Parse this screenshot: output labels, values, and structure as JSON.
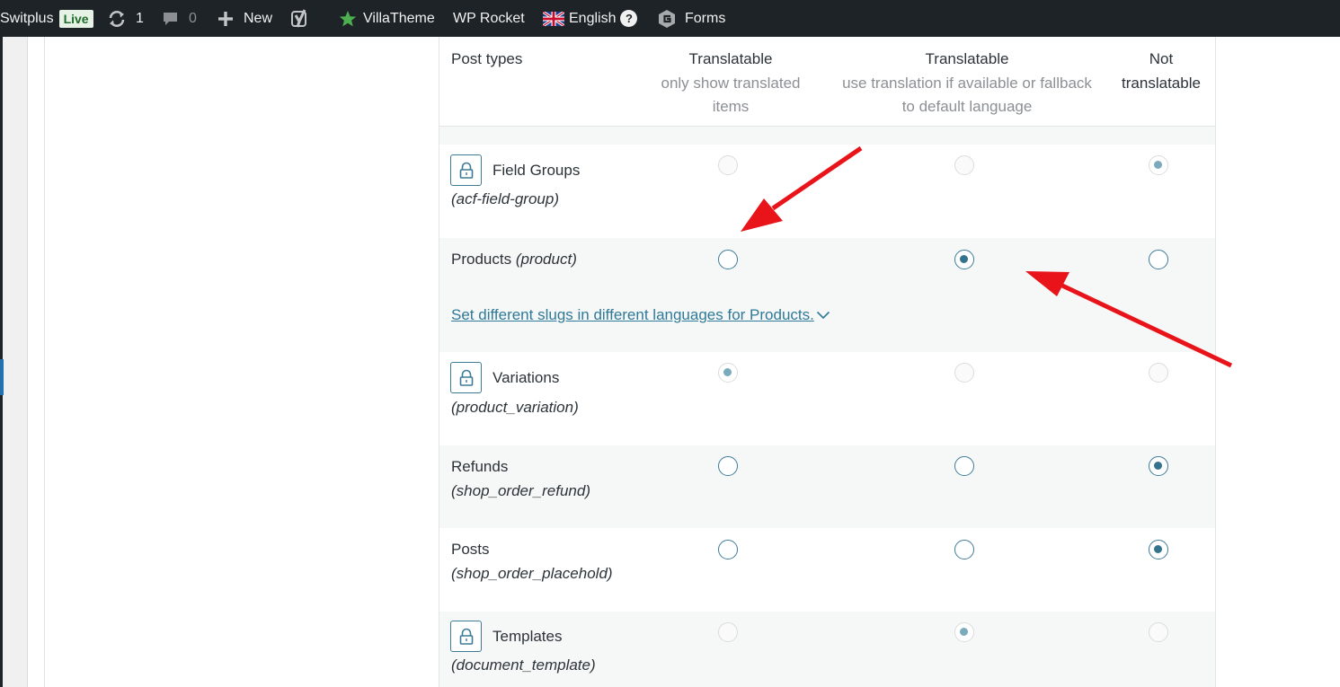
{
  "admin_bar": {
    "site_name": "Switplus",
    "live_badge": "Live",
    "updates_count": "1",
    "comments_count": "0",
    "new_label": "New",
    "villatheme_label": "VillaTheme",
    "wp_rocket_label": "WP Rocket",
    "language_label": "English",
    "help_symbol": "?",
    "forms_label": "Forms"
  },
  "table": {
    "headers": {
      "post_types": "Post types",
      "translate_only": {
        "title": "Translatable",
        "subtitle_line1": "only show translated",
        "subtitle_line2": "items"
      },
      "translate_fallback": {
        "title": "Translatable",
        "subtitle_line1": "use translation if available or fallback",
        "subtitle_line2": "to default language"
      },
      "not_translatable": {
        "line1": "Not",
        "line2": "translatable"
      }
    },
    "rows": [
      {
        "name": "Field Groups",
        "slug": "(acf-field-group)",
        "locked": true,
        "selected": "not_translatable"
      },
      {
        "name": "Products",
        "slug": "(product)",
        "locked": false,
        "selected": "translate_fallback",
        "slug_link": "Set different slugs in different languages for Products."
      },
      {
        "name": "Variations",
        "slug": "(product_variation)",
        "locked": true,
        "selected": "translate_only"
      },
      {
        "name": "Refunds",
        "slug": "(shop_order_refund)",
        "locked": false,
        "selected": "not_translatable"
      },
      {
        "name": "Posts",
        "slug": "(shop_order_placehold)",
        "locked": false,
        "selected": "not_translatable"
      },
      {
        "name": "Templates",
        "slug": "(document_template)",
        "locked": true,
        "selected": "translate_fallback"
      }
    ]
  },
  "colors": {
    "admin_bar_bg": "#1d2327",
    "accent": "#33748c",
    "link": "#2f7a98",
    "arrow": "#e8141a",
    "star": "#4caf50"
  },
  "icons": {
    "updates": "refresh-icon",
    "comments": "comment-bubble-icon",
    "new": "plus-icon",
    "yoast": "yoast-y-icon",
    "villatheme": "star-icon",
    "language": "uk-flag-icon",
    "forms": "gravity-forms-icon",
    "lock": "lock-icon",
    "chevron": "chevron-down-icon"
  }
}
